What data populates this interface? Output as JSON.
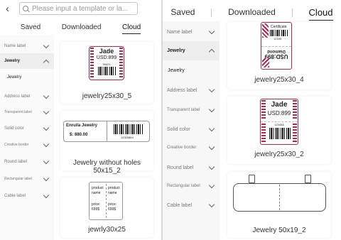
{
  "left": {
    "back_glyph": "‹",
    "search_placeholder": "Please input a template or la...",
    "tabs": [
      "Saved",
      "Downloaded",
      "Cloud"
    ],
    "sidebar": [
      "Name label",
      "Jewelry",
      "Jewelry",
      "Address label",
      "Transparent label",
      "Solid color",
      "Creative border",
      "Round label",
      "Rectangular label",
      "Cable label"
    ],
    "cards": [
      {
        "title": "jewelry25x30_5",
        "head": "Jade",
        "price": "USD:899",
        "code": "95421"
      },
      {
        "title": "Jewelry without holes 50x15_2",
        "head": "Enruila Jewelry",
        "price": "$:  880.00",
        "code": "12315864"
      },
      {
        "title": "jewrly30x25",
        "product": "product",
        "name": "name",
        "price_label": "price:",
        "price": "699$"
      }
    ]
  },
  "right": {
    "tabs": [
      "Saved",
      "Downloaded",
      "Cloud"
    ],
    "sidebar": [
      "Name label",
      "Jewelry",
      "Jewelry",
      "Address label",
      "Transparent label",
      "Solid color",
      "Creative border",
      "Round label",
      "Rectangular label",
      "Cable label"
    ],
    "cards": [
      {
        "title": "jewelry25x30_4",
        "top": "Certificate",
        "code": "12345",
        "bottom": "Diamond",
        "price": "USD:899"
      },
      {
        "title": "jewelry25x30_2",
        "head": "Jade",
        "price": "USD:899",
        "code": "12345&"
      },
      {
        "title": "Jewelry 50x19_2"
      }
    ]
  },
  "colors": {
    "accent_red": "#b6244a",
    "tab_underline": "#222222",
    "active_side_bg": "#eeeeee"
  }
}
